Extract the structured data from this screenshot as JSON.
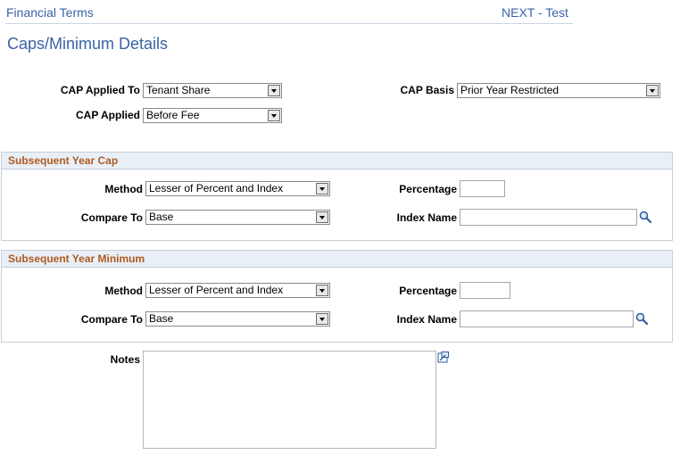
{
  "header": {
    "left_link": "Financial Terms",
    "right_link": "NEXT - Test"
  },
  "page_title": "Caps/Minimum Details",
  "cap": {
    "applied_to_label": "CAP Applied To",
    "applied_to_value": "Tenant Share",
    "basis_label": "CAP Basis",
    "basis_value": "Prior Year Restricted",
    "applied_label": "CAP Applied",
    "applied_value": "Before Fee"
  },
  "subsequent_cap": {
    "title": "Subsequent Year Cap",
    "method_label": "Method",
    "method_value": "Lesser of Percent and Index",
    "percentage_label": "Percentage",
    "percentage_value": "",
    "compare_label": "Compare To",
    "compare_value": "Base",
    "index_label": "Index Name",
    "index_value": ""
  },
  "subsequent_min": {
    "title": "Subsequent Year Minimum",
    "method_label": "Method",
    "method_value": "Lesser of Percent and Index",
    "percentage_label": "Percentage",
    "percentage_value": "",
    "compare_label": "Compare To",
    "compare_value": "Base",
    "index_label": "Index Name",
    "index_value": ""
  },
  "notes": {
    "label": "Notes",
    "value": ""
  },
  "icons": {
    "lookup": "magnifier-icon",
    "expand": "expand-window-icon",
    "dropdown": "chevron-down-icon"
  },
  "colors": {
    "link": "#3a63a6",
    "section_title": "#b05a20",
    "section_header_bg": "#e9eff6",
    "border": "#c5ced8"
  }
}
